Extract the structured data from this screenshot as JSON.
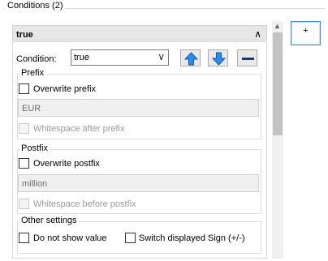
{
  "conditions": {
    "group_title": "Conditions (2)",
    "add_button": "+"
  },
  "item": {
    "header_label": "true",
    "condition_label": "Condition:",
    "condition_value": "true"
  },
  "prefix": {
    "title": "Prefix",
    "overwrite_label": "Overwrite prefix",
    "value": "EUR",
    "whitespace_label": "Whitespace after prefix"
  },
  "postfix": {
    "title": "Postfix",
    "overwrite_label": "Overwrite postfix",
    "value": "million",
    "whitespace_label": "Whitespace before postfix"
  },
  "other": {
    "title": "Other settings",
    "hide_value_label": "Do not show value",
    "switch_sign_label": "Switch displayed Sign (+/-)"
  },
  "icons": {
    "up": "arrow-up-icon",
    "down": "arrow-down-icon",
    "remove": "minus-icon"
  },
  "colors": {
    "arrow_blue": "#1f6fd8",
    "focus_blue": "#3d8ee3"
  }
}
